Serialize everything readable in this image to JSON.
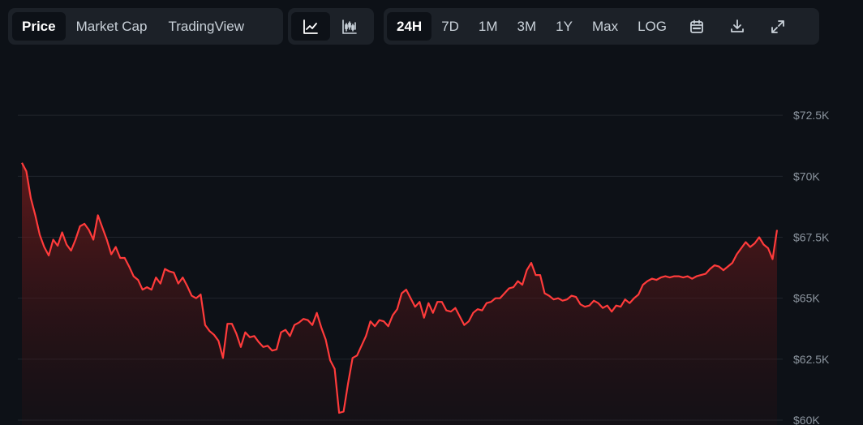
{
  "toolbar": {
    "metric_tabs": [
      "Price",
      "Market Cap",
      "TradingView"
    ],
    "active_metric": "Price",
    "chart_type_icons": [
      "line-chart-icon",
      "candlestick-chart-icon"
    ],
    "ranges": [
      "24H",
      "7D",
      "1M",
      "3M",
      "1Y",
      "Max",
      "LOG"
    ],
    "active_range": "24H",
    "action_icons": [
      "calendar-icon",
      "download-icon",
      "expand-icon"
    ]
  },
  "colors": {
    "line": "#ff3b3b",
    "grid": "#21262d",
    "background": "#0d1117",
    "tick_text": "#8b949e"
  },
  "chart_data": {
    "type": "area",
    "ylim": [
      59800,
      74800
    ],
    "y_ticks": [
      60000,
      62500,
      65000,
      67500,
      70000,
      72500
    ],
    "y_tick_labels": [
      "$60K",
      "$62.5K",
      "$65K",
      "$67.5K",
      "$70K",
      "$72.5K"
    ],
    "grid": true,
    "series": [
      {
        "values": [
          70550,
          70200,
          69100,
          68400,
          67600,
          67100,
          66750,
          67400,
          67150,
          67700,
          67200,
          66950,
          67400,
          67950,
          68050,
          67800,
          67400,
          68400,
          67900,
          67400,
          66800,
          67100,
          66650,
          66650,
          66300,
          65900,
          65750,
          65350,
          65450,
          65350,
          65850,
          65600,
          66200,
          66100,
          66050,
          65600,
          65850,
          65500,
          65100,
          65000,
          65150,
          63900,
          63650,
          63500,
          63250,
          62550,
          63950,
          63950,
          63550,
          63000,
          63600,
          63400,
          63450,
          63200,
          63000,
          63050,
          62850,
          62900,
          63600,
          63700,
          63450,
          63900,
          64000,
          64150,
          64100,
          63900,
          64400,
          63800,
          63300,
          62450,
          62100,
          60300,
          60350,
          61500,
          62550,
          62650,
          63050,
          63450,
          64050,
          63850,
          64100,
          64050,
          63850,
          64300,
          64550,
          65200,
          65350,
          65000,
          64650,
          64850,
          64200,
          64800,
          64400,
          64850,
          64850,
          64500,
          64450,
          64600,
          64250,
          63900,
          64050,
          64400,
          64550,
          64500,
          64800,
          64850,
          65000,
          65000,
          65200,
          65400,
          65450,
          65700,
          65550,
          66150,
          66450,
          65950,
          65950,
          65200,
          65100,
          64950,
          65000,
          64900,
          64950,
          65100,
          65050,
          64750,
          64650,
          64700,
          64900,
          64800,
          64600,
          64700,
          64450,
          64700,
          64650,
          64950,
          64800,
          65000,
          65150,
          65550,
          65700,
          65800,
          65750,
          65850,
          65900,
          65850,
          65900,
          65900,
          65850,
          65900,
          65800,
          65900,
          65950,
          66000,
          66200,
          66350,
          66300,
          66150,
          66300,
          66450,
          66800,
          67050,
          67300,
          67100,
          67250,
          67500,
          67200,
          67050,
          66600,
          67800
        ]
      }
    ]
  }
}
